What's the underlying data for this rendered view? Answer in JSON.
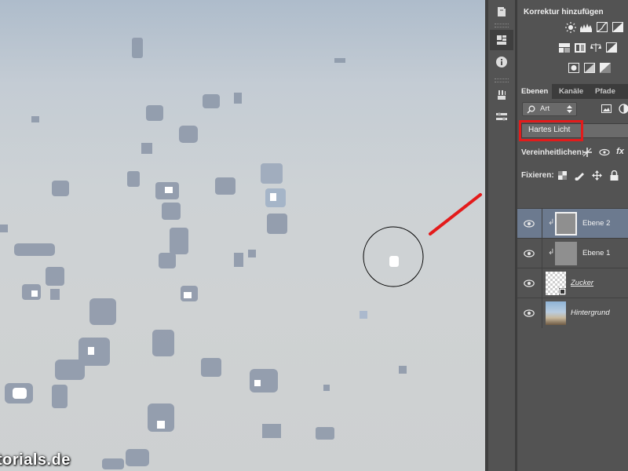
{
  "canvas": {
    "watermark": "torials.de"
  },
  "adjustments_panel": {
    "title": "Korrektur hinzufügen",
    "icons_row1": [
      "brightness-contrast-icon",
      "levels-icon",
      "curves-icon",
      "exposure-icon"
    ],
    "icons_row2": [
      "vibrance-icon",
      "hue-saturation-icon",
      "color-balance-icon",
      "black-white-icon"
    ],
    "icons_row3": [
      "photo-filter-icon",
      "channel-mixer-icon",
      "color-lookup-icon"
    ]
  },
  "layers_panel": {
    "tabs": [
      {
        "label": "Ebenen",
        "active": true
      },
      {
        "label": "Kanäle",
        "active": false
      },
      {
        "label": "Pfade",
        "active": false
      }
    ],
    "filter_label": "Art",
    "blend_mode": "Hartes Licht",
    "unify_label": "Vereinheitlichen:",
    "lock_label": "Fixieren:",
    "layers": [
      {
        "name": "Ebene 2",
        "selected": true,
        "clipped": true,
        "thumb": "gray"
      },
      {
        "name": "Ebene 1",
        "selected": false,
        "clipped": true,
        "thumb": "gray"
      },
      {
        "name": "Zucker",
        "selected": false,
        "clipped": false,
        "thumb": "checker"
      },
      {
        "name": "Hintergrund",
        "selected": false,
        "clipped": false,
        "thumb": "photo"
      }
    ]
  },
  "colors": {
    "highlight": "#e31b1b",
    "panel_bg": "#535353",
    "selected_layer": "#6c7a8f"
  }
}
